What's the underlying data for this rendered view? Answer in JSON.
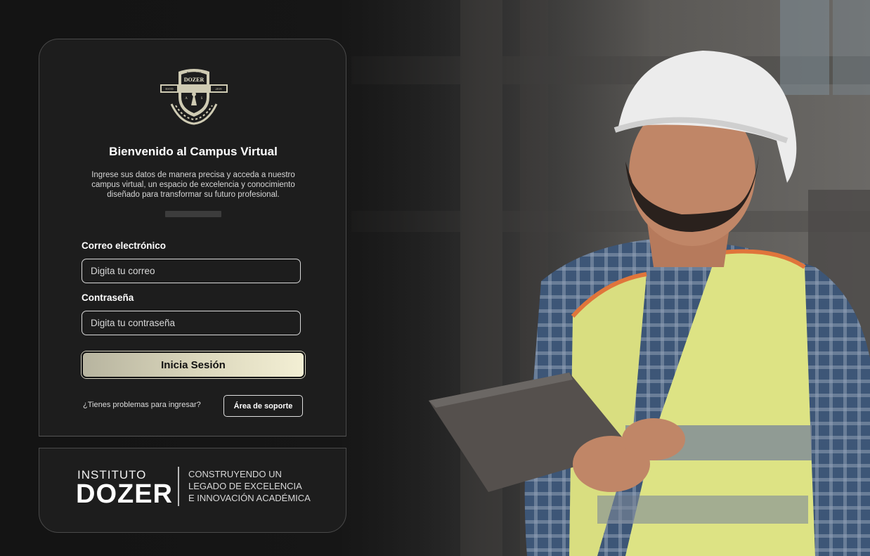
{
  "login": {
    "title": "Bienvenido al Campus Virtual",
    "description": "Ingrese sus datos de manera precisa y acceda a nuestro campus virtual, un espacio de excelencia y conocimiento diseñado para transformar su futuro profesional.",
    "email_label": "Correo electrónico",
    "email_placeholder": "Digita tu correo",
    "password_label": "Contraseña",
    "password_placeholder": "Digita tu contraseña",
    "submit_label": "Inicia Sesión",
    "help_text": "¿Tienes problemas para ingresar?",
    "support_label": "Área de soporte"
  },
  "crest": {
    "top_text": "INSTITUTO",
    "name": "DOZER",
    "left_text": "ESTD",
    "right_text": "2019",
    "letter_left": "A",
    "letter_right": "S"
  },
  "brand": {
    "small": "INSTITUTO",
    "big": "DOZER",
    "tagline_1": "CONSTRUYENDO UN",
    "tagline_2": "LEGADO DE EXCELENCIA",
    "tagline_3": "E INNOVACIÓN ACADÉMICA"
  },
  "icons": {
    "crest": "shield-crest-icon"
  },
  "colors": {
    "button_gradient_start": "#b7b49f",
    "button_gradient_end": "#f3efd4",
    "panel": "#1d1d1d",
    "background": "#1a1a1a"
  }
}
